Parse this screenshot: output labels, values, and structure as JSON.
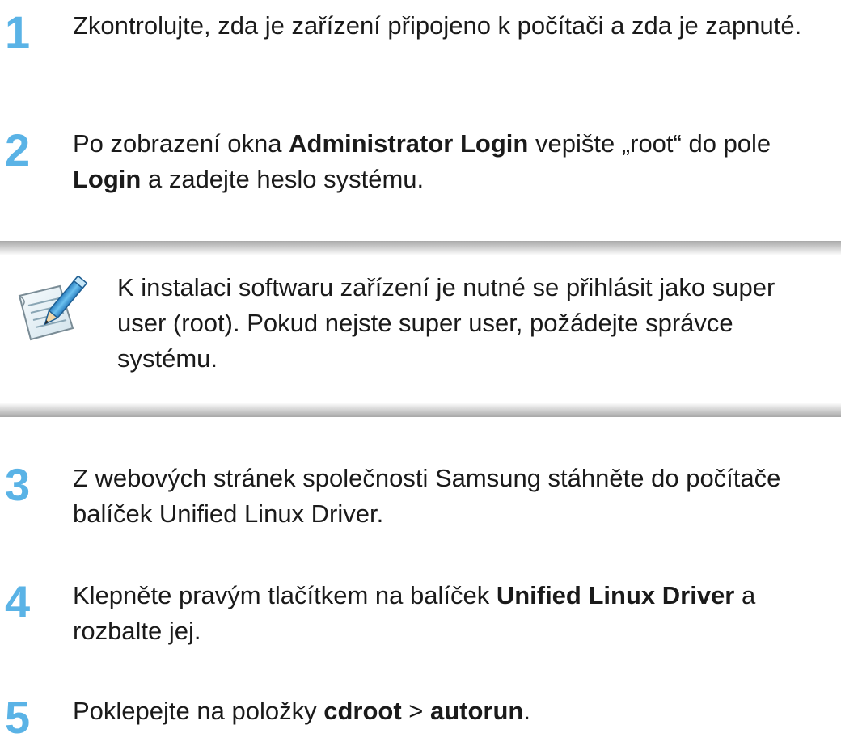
{
  "steps_top": [
    {
      "number": "1",
      "parts": [
        {
          "text": "Zkontrolujte, zda je zařízení připojeno k počítači a zda je zapnuté.",
          "bold": false
        }
      ]
    },
    {
      "number": "2",
      "parts": [
        {
          "text": "Po zobrazení okna ",
          "bold": false
        },
        {
          "text": "Administrator Login",
          "bold": true
        },
        {
          "text": " vepište „root“ do pole ",
          "bold": false
        },
        {
          "text": "Login",
          "bold": true
        },
        {
          "text": " a zadejte heslo systému.",
          "bold": false
        }
      ]
    }
  ],
  "note": {
    "icon": "note-pencil-icon",
    "text": "K instalaci softwaru zařízení je nutné se přihlásit jako super user (root). Pokud nejste super user, požádejte správce systému."
  },
  "steps_bottom": [
    {
      "number": "3",
      "parts": [
        {
          "text": "Z webových stránek společnosti Samsung stáhněte do počítače balíček Unified Linux Driver.",
          "bold": false
        }
      ]
    },
    {
      "number": "4",
      "parts": [
        {
          "text": "Klepněte pravým tlačítkem na balíček ",
          "bold": false
        },
        {
          "text": "Unified Linux Driver",
          "bold": true
        },
        {
          "text": " a rozbalte jej.",
          "bold": false
        }
      ]
    },
    {
      "number": "5",
      "parts": [
        {
          "text": "Poklepejte na položky ",
          "bold": false
        },
        {
          "text": "cdroot",
          "bold": true
        },
        {
          "text": " > ",
          "bold": false
        },
        {
          "text": "autorun",
          "bold": true
        },
        {
          "text": ".",
          "bold": false
        }
      ]
    }
  ],
  "colors": {
    "step_number": "#5ab3e6",
    "text": "#1a1a1a"
  }
}
